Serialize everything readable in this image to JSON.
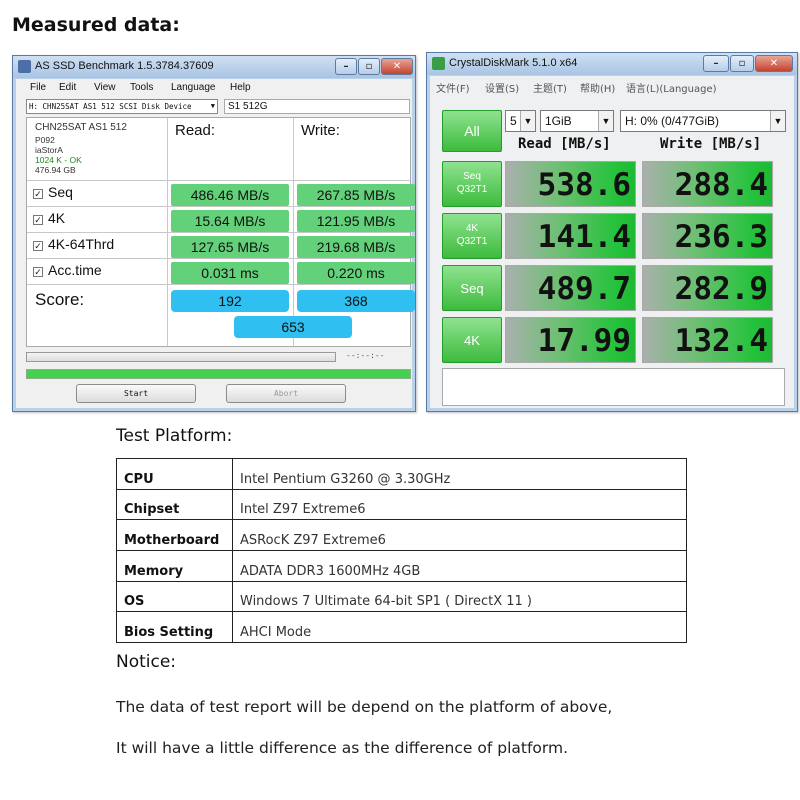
{
  "heading": "Measured data:",
  "as_ssd": {
    "title": "AS SSD Benchmark 1.5.3784.37609",
    "menu": [
      "File",
      "Edit",
      "View",
      "Tools",
      "Language",
      "Help"
    ],
    "drive_select": "H: CHN25SAT AS1 512 SCSI Disk Device",
    "drive_name": "S1 512G",
    "info": {
      "model": "CHN25SAT AS1 512",
      "firmware": "P092",
      "driver": "iaStorA",
      "alignment": "1024 K - OK",
      "size": "476.94 GB"
    },
    "read_header": "Read:",
    "write_header": "Write:",
    "rows": [
      {
        "label": "Seq",
        "read": "486.46 MB/s",
        "write": "267.85 MB/s"
      },
      {
        "label": "4K",
        "read": "15.64 MB/s",
        "write": "121.95 MB/s"
      },
      {
        "label": "4K-64Thrd",
        "read": "127.65 MB/s",
        "write": "219.68 MB/s"
      },
      {
        "label": "Acc.time",
        "read": "0.031 ms",
        "write": "0.220 ms"
      }
    ],
    "score_label": "Score:",
    "score_read": "192",
    "score_write": "368",
    "score_total": "653",
    "time_display": "--:--:--",
    "start_label": "Start",
    "abort_label": "Abort"
  },
  "cdm": {
    "title": "CrystalDiskMark 5.1.0 x64",
    "menu": [
      "文件(F)",
      "设置(S)",
      "主题(T)",
      "帮助(H)",
      "语言(L)(Language)"
    ],
    "all_label": "All",
    "count": "5",
    "size": "1GiB",
    "drive": "H: 0% (0/477GiB)",
    "read_header": "Read [MB/s]",
    "write_header": "Write [MB/s]",
    "tests": [
      {
        "line1": "Seq",
        "line2": "Q32T1",
        "read": "538.6",
        "write": "288.4"
      },
      {
        "line1": "4K",
        "line2": "Q32T1",
        "read": "141.4",
        "write": "236.3"
      },
      {
        "line1": "Seq",
        "line2": "",
        "read": "489.7",
        "write": "282.9"
      },
      {
        "line1": "4K",
        "line2": "",
        "read": "17.99",
        "write": "132.4"
      }
    ]
  },
  "platform": {
    "title": "Test Platform:",
    "rows": [
      {
        "key": "CPU",
        "value": "Intel Pentium G3260 @ 3.30GHz"
      },
      {
        "key": "Chipset",
        "value": "Intel Z97 Extreme6"
      },
      {
        "key": "Motherboard",
        "value": "ASRocK Z97 Extreme6"
      },
      {
        "key": "Memory",
        "value": "ADATA DDR3 1600MHz 4GB"
      },
      {
        "key": "OS",
        "value": "Windows 7 Ultimate 64-bit SP1 ( DirectX 11 )"
      },
      {
        "key": "Bios Setting",
        "value": "AHCI Mode"
      }
    ]
  },
  "notice": {
    "title": "Notice:",
    "line1": "The data of test report will be depend on the platform of above,",
    "line2": "It will have a little difference as the difference of platform."
  },
  "colors": {
    "as_result_green": "#63d07a",
    "as_score_blue": "#2fbff0",
    "cdm_green": "#25c23c"
  }
}
